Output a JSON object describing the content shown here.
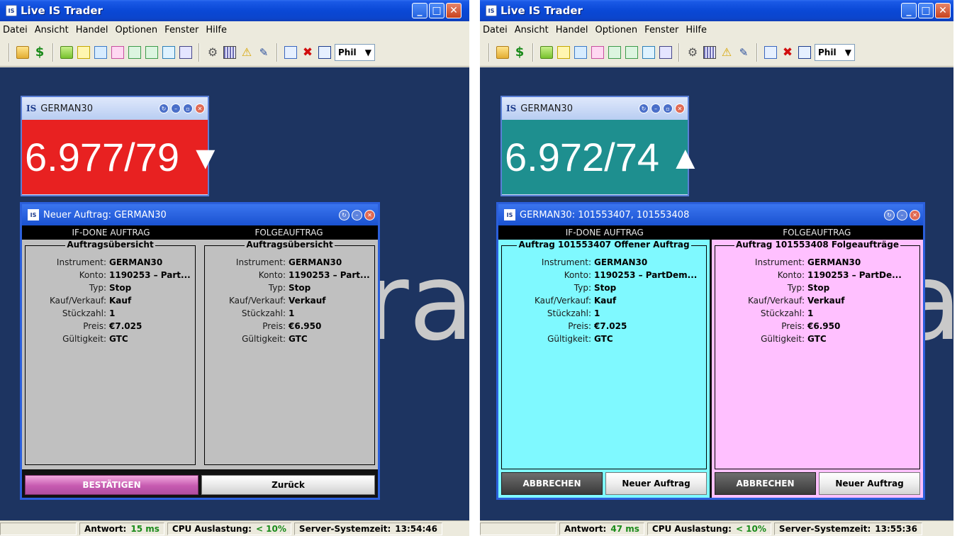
{
  "windows": [
    {
      "title": "Live IS Trader",
      "menu": [
        "Datei",
        "Ansicht",
        "Handel",
        "Optionen",
        "Fenster",
        "Hilfe"
      ],
      "account": "Phil",
      "quote": {
        "symbol": "GERMAN30",
        "price": "6.977/79",
        "direction": "down",
        "color": "#e82121"
      },
      "dialog": {
        "title": "Neuer Auftrag: GERMAN30",
        "col_left": "IF-DONE AUFTRAG",
        "col_right": "FOLGEAUFTRAG",
        "left": {
          "legend": "Auftragsübersicht",
          "fields": [
            {
              "label": "Instrument:",
              "value": "GERMAN30"
            },
            {
              "label": "Konto:",
              "value": "1190253 – Part..."
            },
            {
              "label": "Typ:",
              "value": "Stop"
            },
            {
              "label": "Kauf/Verkauf:",
              "value": "Kauf"
            },
            {
              "label": "Stückzahl:",
              "value": "1"
            },
            {
              "label": "Preis:",
              "value": "€7.025"
            },
            {
              "label": "Gültigkeit:",
              "value": "GTC"
            }
          ]
        },
        "right": {
          "legend": "Auftragsübersicht",
          "fields": [
            {
              "label": "Instrument:",
              "value": "GERMAN30"
            },
            {
              "label": "Konto:",
              "value": "1190253 – Part..."
            },
            {
              "label": "Typ:",
              "value": "Stop"
            },
            {
              "label": "Kauf/Verkauf:",
              "value": "Verkauf"
            },
            {
              "label": "Stückzahl:",
              "value": "1"
            },
            {
              "label": "Preis:",
              "value": "€6.950"
            },
            {
              "label": "Gültigkeit:",
              "value": "GTC"
            }
          ]
        },
        "confirm": "BESTÄTIGEN",
        "back": "Zurück"
      },
      "status": {
        "antwort_label": "Antwort:",
        "antwort": "15 ms",
        "cpu_label": "CPU Auslastung:",
        "cpu": "< 10%",
        "time_label": "Server-Systemzeit:",
        "time": "13:54:46"
      }
    },
    {
      "title": "Live IS Trader",
      "menu": [
        "Datei",
        "Ansicht",
        "Handel",
        "Optionen",
        "Fenster",
        "Hilfe"
      ],
      "account": "Phil",
      "quote": {
        "symbol": "GERMAN30",
        "price": "6.972/74",
        "direction": "up",
        "color": "#1e8f8f"
      },
      "dialog": {
        "title": "GERMAN30: 101553407, 101553408",
        "col_left": "IF-DONE AUFTRAG",
        "col_right": "FOLGEAUFTRAG",
        "left": {
          "legend": "Auftrag 101553407 Offener Auftrag",
          "fields": [
            {
              "label": "Instrument:",
              "value": "GERMAN30"
            },
            {
              "label": "Konto:",
              "value": "1190253 – PartDem..."
            },
            {
              "label": "Typ:",
              "value": "Stop"
            },
            {
              "label": "Kauf/Verkauf:",
              "value": "Kauf"
            },
            {
              "label": "Stückzahl:",
              "value": "1"
            },
            {
              "label": "Preis:",
              "value": "€7.025"
            },
            {
              "label": "Gültigkeit:",
              "value": "GTC"
            }
          ],
          "cancel": "ABBRECHEN",
          "new": "Neuer Auftrag"
        },
        "right": {
          "legend": "Auftrag 101553408 Folgeaufträge",
          "fields": [
            {
              "label": "Instrument:",
              "value": "GERMAN30"
            },
            {
              "label": "Konto:",
              "value": "1190253 – PartDe..."
            },
            {
              "label": "Typ:",
              "value": "Stop"
            },
            {
              "label": "Kauf/Verkauf:",
              "value": "Verkauf"
            },
            {
              "label": "Stückzahl:",
              "value": "1"
            },
            {
              "label": "Preis:",
              "value": "€6.950"
            },
            {
              "label": "Gültigkeit:",
              "value": "GTC"
            }
          ],
          "cancel": "ABBRECHEN",
          "new": "Neuer Auftrag"
        }
      },
      "status": {
        "antwort_label": "Antwort:",
        "antwort": "47 ms",
        "cpu_label": "CPU Auslastung:",
        "cpu": "< 10%",
        "time_label": "Server-Systemzeit:",
        "time": "13:55:36"
      }
    }
  ],
  "colors": {
    "desktop": "#1d3461",
    "left_panel_right": "#ffc0ff",
    "left_panel_cyan": "#7ff9ff",
    "panel_gray": "#c0c0c0"
  }
}
